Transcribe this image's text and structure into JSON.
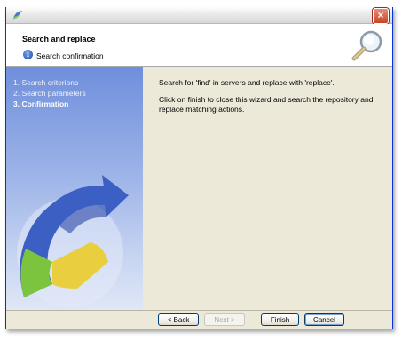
{
  "window": {
    "close_label": "×"
  },
  "header": {
    "title": "Search and replace",
    "subtitle": "Search confirmation",
    "info_glyph": "i"
  },
  "sidebar": {
    "steps": [
      {
        "label": "1. Search criterions"
      },
      {
        "label": "2. Search parameters"
      },
      {
        "label": "3. Confirmation"
      }
    ]
  },
  "content": {
    "para1": "Search for 'find' in servers and replace with 'replace'.",
    "para2": "Click on finish to close this wizard and search the repository and replace matching actions."
  },
  "buttons": {
    "back": "< Back",
    "next": "Next >",
    "finish": "Finish",
    "cancel": "Cancel"
  },
  "icons": {
    "app": "app-logo-icon",
    "info": "info-icon",
    "search": "magnifier-icon",
    "close": "close-icon"
  }
}
